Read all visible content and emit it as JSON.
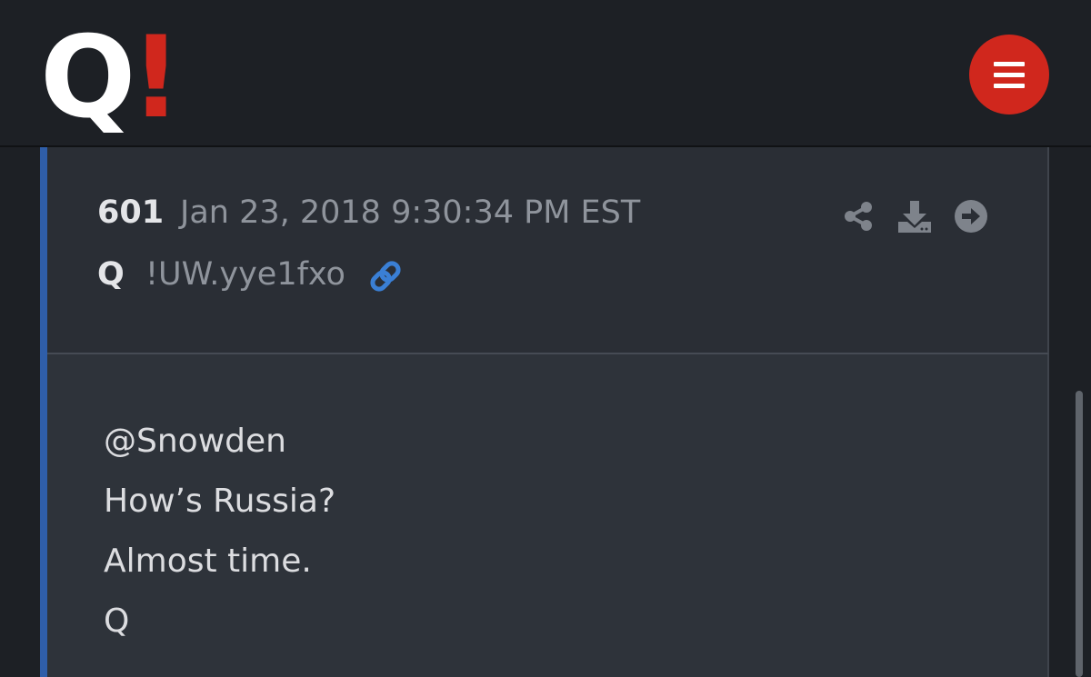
{
  "header": {
    "logo_text": "Q",
    "logo_mark": "!",
    "logo_mark_color": "#d0271d",
    "menu_icon": "hamburger-icon",
    "menu_button_color": "#d0271d"
  },
  "post": {
    "number": "601",
    "date": "Jan 23, 2018 9:30:34 PM EST",
    "author": "Q",
    "tripcode": "!UW.yye1fxo",
    "link_icon": "link-icon",
    "link_icon_color": "#3a7fd5",
    "actions": [
      "share-icon",
      "download-icon",
      "arrow-right-circle-icon"
    ],
    "body_lines": [
      "@Snowden",
      "How’s Russia?",
      "Almost time.",
      "Q"
    ]
  },
  "colors": {
    "accent_rail": "#2f5ea9",
    "background": "#1d2025",
    "header_panel": "#2a2e35",
    "body_panel": "#2e333a"
  }
}
